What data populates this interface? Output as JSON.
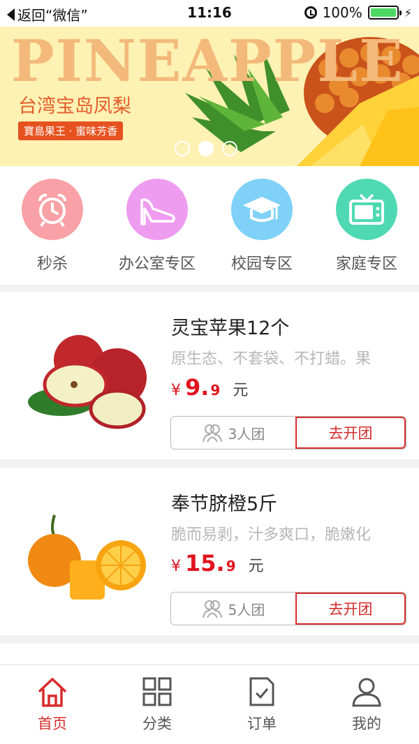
{
  "status_bar": {
    "back_label": "返回“微信”",
    "time": "11:16",
    "battery": "100%"
  },
  "banner": {
    "headline": "PINEAPPLE",
    "subtitle": "台湾宝岛凤梨",
    "tag": "寶島果王 · 蜜味芳香",
    "slide_count": 3,
    "active_slide": 2
  },
  "categories": [
    {
      "label": "秒杀",
      "icon": "alarm-clock-icon",
      "color": "#f9a1a6"
    },
    {
      "label": "办公室专区",
      "icon": "high-heel-icon",
      "color": "#ee9cf0"
    },
    {
      "label": "校园专区",
      "icon": "graduation-cap-icon",
      "color": "#7fd1f7"
    },
    {
      "label": "家庭专区",
      "icon": "tv-icon",
      "color": "#4fd9b3"
    }
  ],
  "products": [
    {
      "title": "灵宝苹果12个",
      "desc": "原生态、不套袋、不打蜡。果",
      "price_symbol": "¥",
      "price_int": "9.",
      "price_dec": "9",
      "unit": "元",
      "group_size": "3人团",
      "cta": "去开团",
      "image": "apples"
    },
    {
      "title": "奉节脐橙5斤",
      "desc": "脆而易剥，汁多爽口，脆嫩化",
      "price_symbol": "¥",
      "price_int": "15.",
      "price_dec": "9",
      "unit": "元",
      "group_size": "5人团",
      "cta": "去开团",
      "image": "oranges"
    }
  ],
  "tabs": [
    {
      "label": "首页",
      "icon": "home-icon",
      "active": true
    },
    {
      "label": "分类",
      "icon": "grid-icon",
      "active": false
    },
    {
      "label": "订单",
      "icon": "order-icon",
      "active": false
    },
    {
      "label": "我的",
      "icon": "user-icon",
      "active": false
    }
  ],
  "accent_color": "#d72c2c"
}
